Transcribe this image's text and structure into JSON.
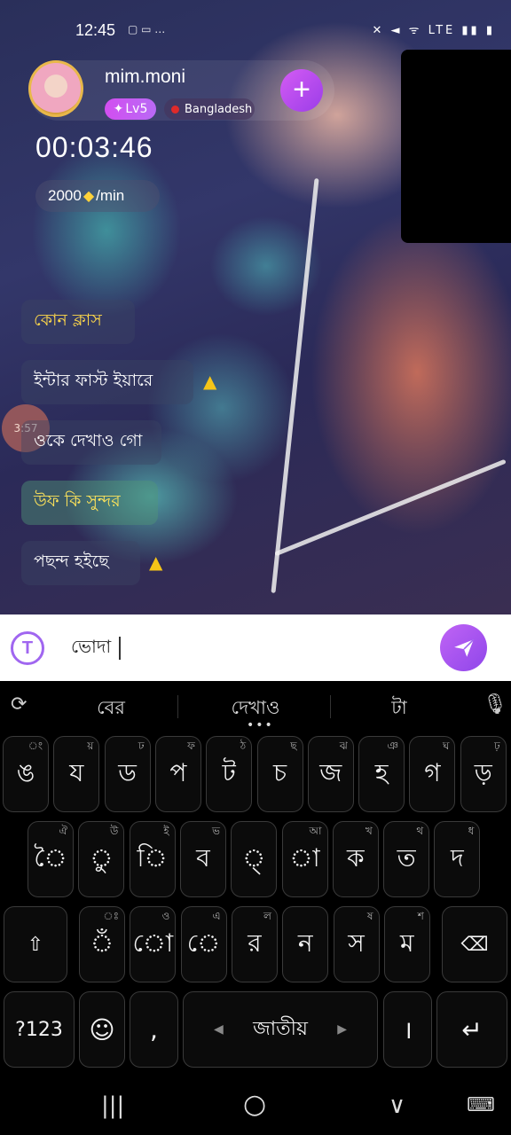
{
  "status_bar": {
    "time": "12:45",
    "left_icons": "▢ ▭ …",
    "right_icons": "✕ ◄ ᯤ LTE ▮▮ ▮"
  },
  "host": {
    "name": "mim.moni",
    "level": "Lv5",
    "country": "Bangladesh",
    "follow_label": "+"
  },
  "call": {
    "timer": "00:03:46",
    "rate_value": "2000",
    "rate_unit": "/min"
  },
  "chat_messages": [
    {
      "text": "কোন ক্লাস",
      "warning": false
    },
    {
      "text": "ইন্টার ফাস্ট ইয়ারে",
      "warning": true
    },
    {
      "text": "ওকে দেখাও গো",
      "warning": false
    },
    {
      "text": "উফ কি সুন্দর",
      "warning": false
    },
    {
      "text": "পছন্দ হইছে",
      "warning": true
    }
  ],
  "time_marker": "3:57",
  "input": {
    "value": "ভোদা",
    "translate_icon": "T"
  },
  "keyboard": {
    "suggestions": [
      "বের",
      "দেখাও",
      "টা"
    ],
    "row1": [
      {
        "label": "ঙ",
        "hint": "ং"
      },
      {
        "label": "য",
        "hint": "য়"
      },
      {
        "label": "ড",
        "hint": "ঢ"
      },
      {
        "label": "প",
        "hint": "ফ"
      },
      {
        "label": "ট",
        "hint": "ঠ"
      },
      {
        "label": "চ",
        "hint": "ছ"
      },
      {
        "label": "জ",
        "hint": "ঝ"
      },
      {
        "label": "হ",
        "hint": "ঞ"
      },
      {
        "label": "গ",
        "hint": "ঘ"
      },
      {
        "label": "ড়",
        "hint": "ঢ়"
      }
    ],
    "row2": [
      {
        "label": "ৈ",
        "hint": "ঐ"
      },
      {
        "label": "ু",
        "hint": "উ"
      },
      {
        "label": "ি",
        "hint": "ই"
      },
      {
        "label": "ব",
        "hint": "ভ"
      },
      {
        "label": "্",
        "hint": ""
      },
      {
        "label": "া",
        "hint": "আ"
      },
      {
        "label": "ক",
        "hint": "খ"
      },
      {
        "label": "ত",
        "hint": "থ"
      },
      {
        "label": "দ",
        "hint": "ধ"
      }
    ],
    "row3": [
      {
        "label": "ঁ",
        "hint": "ঃ"
      },
      {
        "label": "ো",
        "hint": "ও"
      },
      {
        "label": "ে",
        "hint": "এ"
      },
      {
        "label": "র",
        "hint": "ল"
      },
      {
        "label": "ন",
        "hint": ""
      },
      {
        "label": "স",
        "hint": "ষ"
      },
      {
        "label": "ম",
        "hint": "শ"
      }
    ],
    "shift_label": "⇧",
    "backspace_label": "⌫",
    "symbols_label": "?123",
    "emoji_label": "☺",
    "comma_label": ",",
    "space_label": "জাতীয়",
    "period_label": "।",
    "enter_label": "↵"
  },
  "navbar": {
    "recents": "|||",
    "home": "○",
    "back": "∨",
    "keyboard": "⌨"
  },
  "colors": {
    "accent": "#a066f0",
    "chat_gold": "#ffd94a",
    "warning": "#f5c518"
  }
}
